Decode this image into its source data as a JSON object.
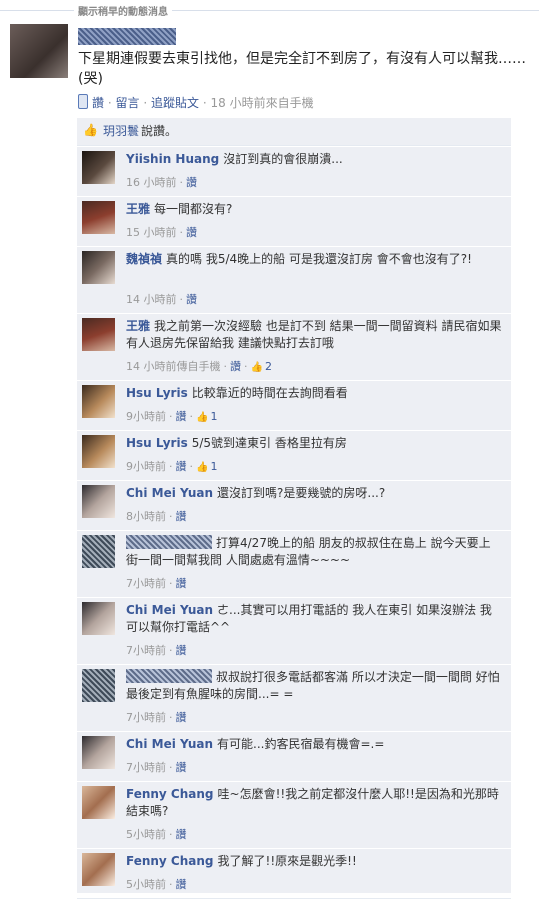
{
  "header": {
    "title": "顯示稍早的動態消息"
  },
  "post": {
    "body": "下星期連假要去東引找他，但是完全訂不到房了，有沒有人可以幫我……(哭)",
    "like_label": "讚",
    "comment_label": "留言",
    "follow_label": "追蹤貼文",
    "time": "18 小時前來自手機",
    "sep": "·"
  },
  "likes": {
    "user": "玥羽鬟",
    "text": "說讚。"
  },
  "comments": [
    {
      "name": "Yiishin Huang",
      "text": "沒訂到真的會很崩潰...",
      "time": "16 小時前",
      "like": "讚",
      "count": ""
    },
    {
      "name": "王雅",
      "text": "每一間都沒有?",
      "time": "15 小時前",
      "like": "讚",
      "count": ""
    },
    {
      "name": "魏禎禎",
      "text": "真的嗎 我5/4晚上的船 可是我還沒訂房 會不會也沒有了?!",
      "time": "14 小時前",
      "like": "讚",
      "count": ""
    },
    {
      "name": "王雅",
      "text": "我之前第一次沒經驗 也是訂不到 結果一間一間留資料 請民宿如果有人退房先保留給我 建議快點打去訂哦",
      "time": "14 小時前傳自手機",
      "like": "讚",
      "count": "2"
    },
    {
      "name": "Hsu Lyris",
      "text": "比較靠近的時間在去詢問看看",
      "time": "9小時前",
      "like": "讚",
      "count": "1"
    },
    {
      "name": "Hsu Lyris",
      "text": "5/5號到達東引 香格里拉有房",
      "time": "9小時前",
      "like": "讚",
      "count": "1"
    },
    {
      "name": "Chi Mei Yuan",
      "text": "還沒訂到嗎?是要幾號的房呀...?",
      "time": "8小時前",
      "like": "讚",
      "count": ""
    },
    {
      "name": "",
      "text": "打算4/27晚上的船 朋友的叔叔住在島上 說今天要上街一間一間幫我問 人間處處有溫情~~~~",
      "time": "7小時前",
      "like": "讚",
      "count": ""
    },
    {
      "name": "Chi Mei Yuan",
      "text": "ㄜ...其實可以用打電話的 我人在東引 如果沒辦法 我可以幫你打電話^^",
      "time": "7小時前",
      "like": "讚",
      "count": ""
    },
    {
      "name": "",
      "text": "叔叔說打很多電話都客滿 所以才決定一間一間問 好怕最後定到有魚腥味的房間...= =",
      "time": "7小時前",
      "like": "讚",
      "count": ""
    },
    {
      "name": "Chi Mei Yuan",
      "text": "有可能...釣客民宿最有機會=.=",
      "time": "7小時前",
      "like": "讚",
      "count": ""
    },
    {
      "name": "Fenny Chang",
      "text": "哇~怎麼會!!我之前定都沒什麼人耶!!是因為和光那時結束嗎?",
      "time": "5小時前",
      "like": "讚",
      "count": ""
    },
    {
      "name": "Fenny Chang",
      "text": "我了解了!!原來是觀光季!!",
      "time": "5小時前",
      "like": "讚",
      "count": ""
    }
  ],
  "colors": {
    "link": "#3b5998",
    "feedback_bg": "#edeff4",
    "meta": "#999999"
  },
  "icons": {
    "mobile": "mobile-phone-icon",
    "like": "thumbs-up-icon"
  }
}
